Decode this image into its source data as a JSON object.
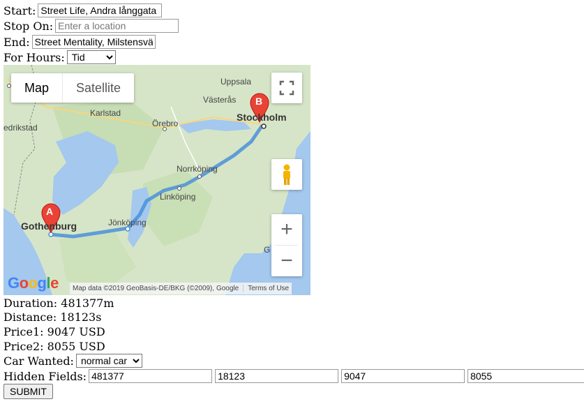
{
  "form": {
    "start_label": "Start:",
    "start_value": "Street Life, Andra långgata",
    "stop_label": "Stop On:",
    "stop_placeholder": "Enter a location",
    "end_label": "End:",
    "end_value": "Street Mentality, Milstensvägen",
    "hours_label": "For Hours:",
    "hours_value": "Tid"
  },
  "map": {
    "type_map": "Map",
    "type_satellite": "Satellite",
    "marker_a": "A",
    "marker_b": "B",
    "cities": {
      "uppsala": "Uppsala",
      "vasteras": "Västerås",
      "stockholm": "Stockholm",
      "karlstad": "Karlstad",
      "orebro": "Örebro",
      "edrikstad": "edrikstad",
      "norrkoping": "Norrköping",
      "linkoping": "Linköping",
      "jonkoping": "Jönköping",
      "gothenburg": "Gothenburg",
      "g": "G"
    },
    "attribution": "Map data ©2019 GeoBasis-DE/BKG (©2009), Google",
    "terms": "Terms of Use",
    "logo": "Google"
  },
  "results": {
    "duration": "Duration: 481377m",
    "distance": "Distance: 18123s",
    "price1": "Price1: 9047 USD",
    "price2": "Price2: 8055 USD"
  },
  "car": {
    "label": "Car Wanted:",
    "value": "normal car"
  },
  "hidden": {
    "label": "Hidden Fields:",
    "f1": "481377",
    "f2": "18123",
    "f3": "9047",
    "f4": "8055"
  },
  "submit_label": "SUBMIT"
}
